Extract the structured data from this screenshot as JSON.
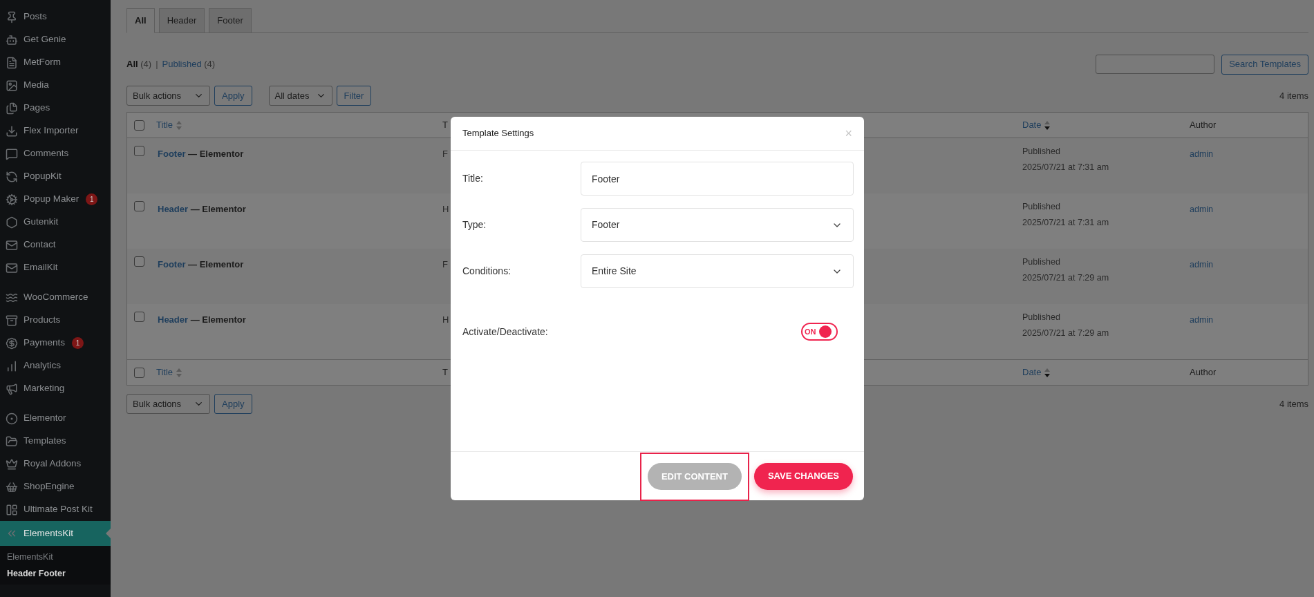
{
  "sidebar": {
    "groups": [
      {
        "items": [
          {
            "label": "Posts",
            "selected": false
          },
          {
            "label": "Get Genie",
            "selected": false
          },
          {
            "label": "MetForm",
            "selected": false
          },
          {
            "label": "Media",
            "selected": false
          },
          {
            "label": "Pages",
            "selected": false
          },
          {
            "label": "Flex Importer",
            "selected": false
          },
          {
            "label": "Comments",
            "selected": false
          },
          {
            "label": "PopupKit",
            "selected": false
          },
          {
            "label": "Popup Maker",
            "badge": "1",
            "selected": false
          },
          {
            "label": "Gutenkit",
            "selected": false
          },
          {
            "label": "Contact",
            "selected": false
          },
          {
            "label": "EmailKit",
            "selected": false
          }
        ]
      },
      {
        "items": [
          {
            "label": "WooCommerce",
            "selected": false
          },
          {
            "label": "Products",
            "selected": false
          },
          {
            "label": "Payments",
            "badge": "1",
            "selected": false
          },
          {
            "label": "Analytics",
            "selected": false
          },
          {
            "label": "Marketing",
            "selected": false
          }
        ]
      },
      {
        "items": [
          {
            "label": "Elementor",
            "selected": false
          },
          {
            "label": "Templates",
            "selected": false
          },
          {
            "label": "Royal Addons",
            "selected": false
          },
          {
            "label": "ShopEngine",
            "selected": false
          },
          {
            "label": "Ultimate Post Kit",
            "selected": false
          },
          {
            "label": "ElementsKit",
            "selected": true
          }
        ]
      }
    ],
    "submenu": [
      {
        "label": "ElementsKit",
        "selected": false
      },
      {
        "label": "Header Footer",
        "selected": true
      }
    ]
  },
  "tabs": [
    {
      "label": "All",
      "selected": true
    },
    {
      "label": "Header",
      "selected": false
    },
    {
      "label": "Footer",
      "selected": false
    }
  ],
  "filters": [
    {
      "label": "All",
      "count": "(4)",
      "selected": true
    },
    {
      "label": "Published",
      "count": "(4)",
      "selected": false
    }
  ],
  "filter_separator": "|",
  "search": {
    "button": "Search Templates"
  },
  "top_actions": {
    "bulk": "Bulk actions",
    "apply": "Apply",
    "dates": "All dates",
    "filter": "Filter",
    "count": "4 items"
  },
  "table": {
    "header": {
      "checked": false,
      "columns": [
        {
          "label": "Title",
          "sorted": false
        },
        {
          "label": "T"
        },
        {
          "label": "Date",
          "sorted": true
        },
        {
          "label": "Author"
        }
      ]
    },
    "rows": [
      {
        "checked": false,
        "title": "Footer",
        "suffix": " — Elementor",
        "column_2": "F",
        "status": "Published",
        "date": "2025/07/21 at 7:31 am",
        "author": "admin"
      },
      {
        "checked": false,
        "title": "Header",
        "suffix": " — Elementor",
        "column_2": "H",
        "status": "Published",
        "date": "2025/07/21 at 7:31 am",
        "author": "admin"
      },
      {
        "checked": false,
        "title": "Footer",
        "suffix": " — Elementor",
        "column_2": "F",
        "status": "Published",
        "date": "2025/07/21 at 7:29 am",
        "author": "admin"
      },
      {
        "checked": false,
        "title": "Header",
        "suffix": " — Elementor",
        "column_2": "H",
        "status": "Published",
        "date": "2025/07/21 at 7:29 am",
        "author": "admin"
      }
    ],
    "footer": {
      "checked": false,
      "columns": [
        {
          "label": "Title",
          "sorted": false
        },
        {
          "label": "T"
        },
        {
          "label": "Date",
          "sorted": true
        },
        {
          "label": "Author"
        }
      ]
    }
  },
  "bottom_actions": {
    "bulk": "Bulk actions",
    "apply": "Apply",
    "count": "4 items"
  },
  "modal": {
    "title": "Template Settings",
    "close": "×",
    "fields": [
      {
        "kind": "text",
        "label": "Title:",
        "value": "Footer"
      },
      {
        "kind": "select",
        "label": "Type:",
        "value": "Footer"
      },
      {
        "kind": "select",
        "label": "Conditions:",
        "value": "Entire Site"
      },
      {
        "kind": "toggle",
        "label": "Activate/Deactivate:",
        "on": true,
        "state_label": "ON"
      }
    ],
    "buttons": [
      {
        "label": "EDIT CONTENT",
        "kind": "secondary",
        "highlighted": true
      },
      {
        "label": "SAVE CHANGES",
        "kind": "primary",
        "highlighted": false
      }
    ]
  }
}
